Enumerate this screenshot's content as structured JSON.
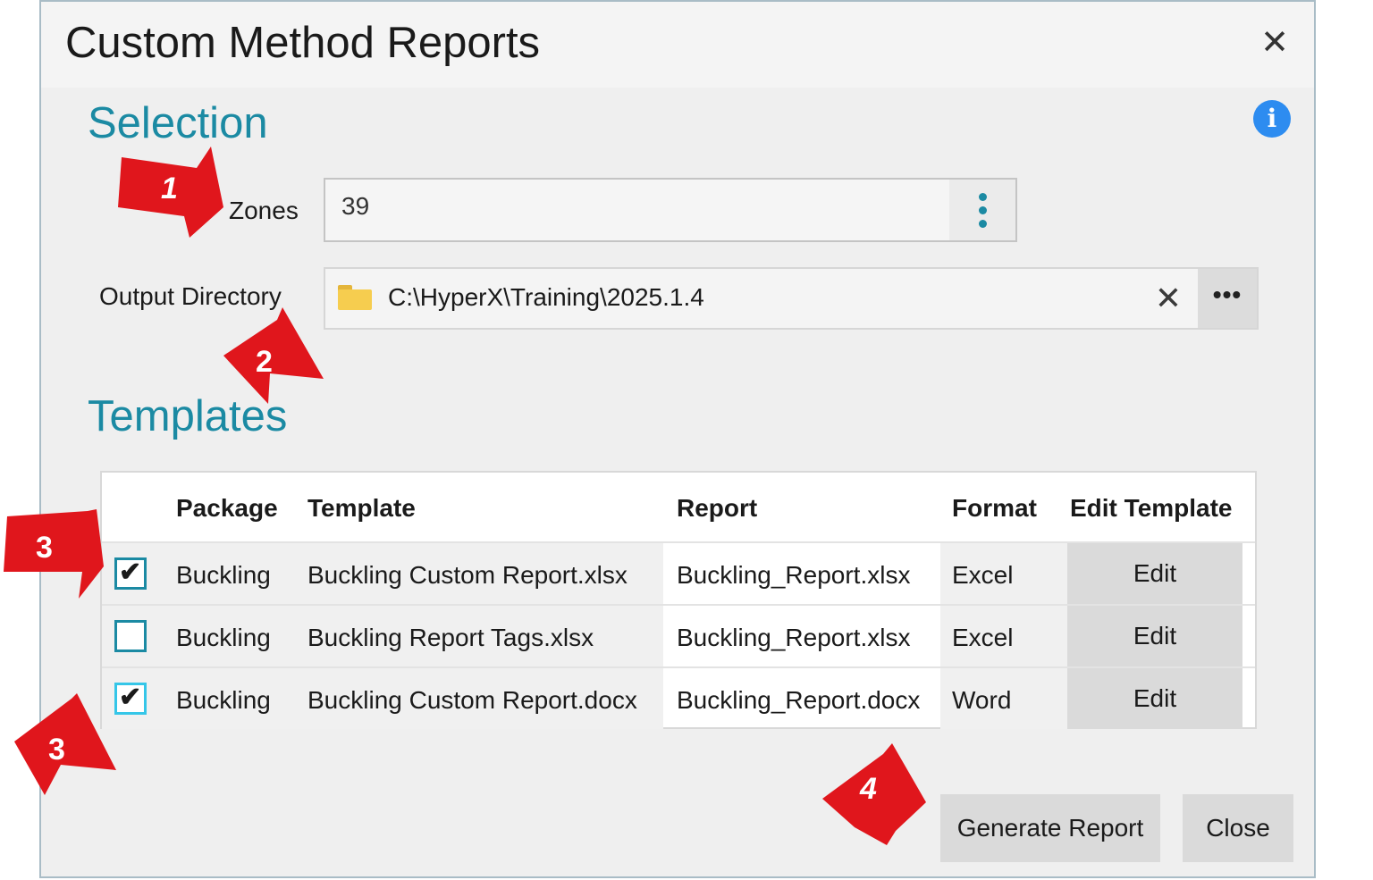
{
  "dialog": {
    "title": "Custom Method Reports",
    "close_glyph": "✕",
    "info_glyph": "i"
  },
  "selection": {
    "heading": "Selection",
    "zones_label": "Zones",
    "zones_value": "39",
    "output_label": "Output Directory",
    "output_value": "C:\\HyperX\\Training\\2025.1.4",
    "clear_glyph": "✕",
    "browse_glyph": "•••"
  },
  "templates": {
    "heading": "Templates",
    "columns": [
      "Package",
      "Template",
      "Report",
      "Format",
      "Edit Template"
    ],
    "rows": [
      {
        "checked": true,
        "package": "Buckling",
        "template": "Buckling Custom Report.xlsx",
        "report": "Buckling_Report.xlsx",
        "format": "Excel",
        "edit": "Edit"
      },
      {
        "checked": false,
        "package": "Buckling",
        "template": "Buckling Report Tags.xlsx",
        "report": "Buckling_Report.xlsx",
        "format": "Excel",
        "edit": "Edit"
      },
      {
        "checked": true,
        "package": "Buckling",
        "template": "Buckling Custom Report.docx",
        "report": "Buckling_Report.docx",
        "format": "Word",
        "edit": "Edit"
      }
    ]
  },
  "footer": {
    "generate_label": "Generate Report",
    "close_label": "Close"
  },
  "callouts": [
    "1",
    "2",
    "3",
    "3",
    "4"
  ],
  "colors": {
    "accent": "#1b8aa3",
    "callout_red": "#e0161c",
    "info_blue": "#2d8cf0"
  },
  "icons": {
    "close": "close-icon",
    "info": "info-icon",
    "kebab": "more-vertical-icon",
    "folder": "folder-icon",
    "clear": "clear-icon",
    "browse": "more-horizontal-icon",
    "checkbox_checked": "checkmark-icon"
  }
}
